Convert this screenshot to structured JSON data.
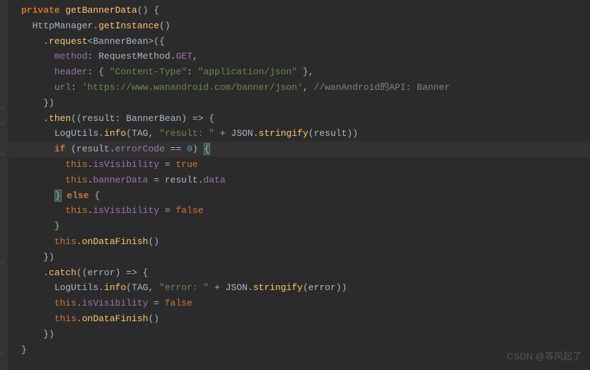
{
  "code": {
    "l1": {
      "kw_private": "private",
      "fn": "getBannerData",
      "paren": "() {"
    },
    "l2": {
      "ind": "  ",
      "obj": "HttpManager",
      "dot": ".",
      "fn": "getInstance",
      "paren": "()"
    },
    "l3": {
      "ind": "    ",
      "dot": ".",
      "fn": "request",
      "lt": "<",
      "type": "BannerBean",
      "gt": ">",
      "paren": "({"
    },
    "l4": {
      "ind": "      ",
      "prop": "method",
      "colon": ": ",
      "obj": "RequestMethod",
      "dot": ".",
      "val": "GET",
      "comma": ","
    },
    "l5": {
      "ind": "      ",
      "prop": "header",
      "colon": ": { ",
      "key": "\"Content-Type\"",
      "sep": ": ",
      "val": "\"application/json\"",
      "close": " },"
    },
    "l6": {
      "ind": "      ",
      "prop": "url",
      "colon": ": ",
      "str": "'https://www.wanandroid.com/banner/json'",
      "comma": ", ",
      "comment": "//wanAndroid的API: Banner"
    },
    "l7": {
      "ind": "    ",
      "close": "})"
    },
    "l8": {
      "ind": "    ",
      "dot": ".",
      "fn": "then",
      "open": "((",
      "param": "result",
      "colon": ": ",
      "type": "BannerBean",
      "arrow": ") => {"
    },
    "l9": {
      "ind": "      ",
      "obj": "LogUtils",
      "dot": ".",
      "fn": "info",
      "open": "(",
      "arg1": "TAG",
      "comma": ", ",
      "str": "\"result: \"",
      "plus": " + ",
      "json": "JSON",
      "dot2": ".",
      "fn2": "stringify",
      "open2": "(",
      "arg2": "result",
      "close": "))"
    },
    "l10": {
      "ind": "      ",
      "kw": "if",
      "open": " (",
      "obj": "result",
      "dot": ".",
      "prop": "errorCode",
      "op": " == ",
      "num": "0",
      "close": ") ",
      "brace": "{"
    },
    "l11": {
      "ind": "        ",
      "kw": "this",
      "dot": ".",
      "prop": "isVisibility",
      "op": " = ",
      "val": "true"
    },
    "l12": {
      "ind": "        ",
      "kw": "this",
      "dot": ".",
      "prop": "bannerData",
      "op": " = ",
      "obj": "result",
      "dot2": ".",
      "prop2": "data"
    },
    "l13": {
      "ind": "      ",
      "brace": "}",
      "sp": " ",
      "kw": "else",
      "sp2": " ",
      "brace2": "{"
    },
    "l14": {
      "ind": "        ",
      "kw": "this",
      "dot": ".",
      "prop": "isVisibility",
      "op": " = ",
      "val": "false"
    },
    "l15": {
      "ind": "      ",
      "brace": "}"
    },
    "l16": {
      "ind": "      ",
      "kw": "this",
      "dot": ".",
      "fn": "onDataFinish",
      "paren": "()"
    },
    "l17": {
      "ind": "    ",
      "close": "})"
    },
    "l18": {
      "ind": "    ",
      "dot": ".",
      "fn": "catch",
      "open": "((",
      "param": "error",
      "arrow": ") => {"
    },
    "l19": {
      "ind": "      ",
      "obj": "LogUtils",
      "dot": ".",
      "fn": "info",
      "open": "(",
      "arg1": "TAG",
      "comma": ", ",
      "str": "\"error: \"",
      "plus": " + ",
      "json": "JSON",
      "dot2": ".",
      "fn2": "stringify",
      "open2": "(",
      "arg2": "error",
      "close": "))"
    },
    "l20": {
      "ind": "      ",
      "kw": "this",
      "dot": ".",
      "prop": "isVisibility",
      "op": " = ",
      "val": "false"
    },
    "l21": {
      "ind": "      ",
      "kw": "this",
      "dot": ".",
      "fn": "onDataFinish",
      "paren": "()"
    },
    "l22": {
      "ind": "    ",
      "close": "})"
    },
    "l23": {
      "ind": "",
      "brace": "}"
    }
  },
  "watermark": "CSDN @等风起了"
}
